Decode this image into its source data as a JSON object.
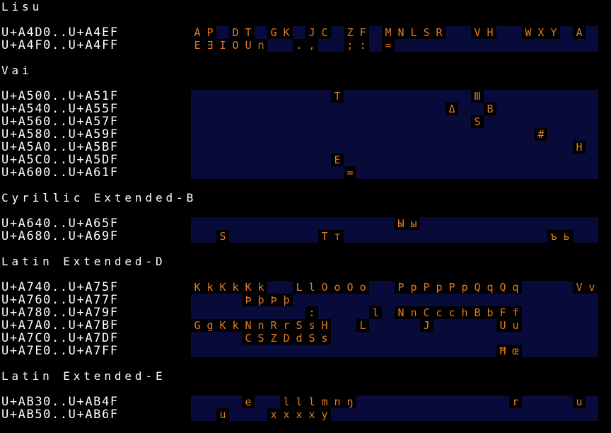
{
  "colors": {
    "background": "#000000",
    "label_text": "#ffffff",
    "row_background": "#080a3a",
    "cell_background": "#000000",
    "glyph_text": "#e07b2a"
  },
  "sections": [
    {
      "title": "Lisu",
      "rows": [
        {
          "range": "U+A4D0..U+A4EF",
          "cells": [
            [
              0,
              "A"
            ],
            [
              1,
              "P"
            ],
            [
              3,
              "D"
            ],
            [
              4,
              "T"
            ],
            [
              6,
              "G"
            ],
            [
              7,
              "K"
            ],
            [
              9,
              "J"
            ],
            [
              10,
              "C"
            ],
            [
              12,
              "Z"
            ],
            [
              13,
              "F"
            ],
            [
              15,
              "M"
            ],
            [
              16,
              "N"
            ],
            [
              17,
              "L"
            ],
            [
              18,
              "S"
            ],
            [
              19,
              "R"
            ],
            [
              22,
              "V"
            ],
            [
              23,
              "H"
            ],
            [
              26,
              "W"
            ],
            [
              27,
              "X"
            ],
            [
              28,
              "Y"
            ],
            [
              30,
              "A"
            ]
          ]
        },
        {
          "range": "U+A4F0..U+A4FF",
          "cells": [
            [
              0,
              "E"
            ],
            [
              1,
              "∃"
            ],
            [
              2,
              "I"
            ],
            [
              3,
              "O"
            ],
            [
              4,
              "U"
            ],
            [
              5,
              "∩"
            ],
            [
              8,
              "."
            ],
            [
              9,
              ","
            ],
            [
              12,
              ";"
            ],
            [
              13,
              ":"
            ],
            [
              15,
              "="
            ]
          ]
        }
      ]
    },
    {
      "title": "Vai",
      "rows": [
        {
          "range": "U+A500..U+A51F",
          "cells": [
            [
              11,
              "T"
            ],
            [
              22,
              "Ⅲ"
            ]
          ]
        },
        {
          "range": "U+A540..U+A55F",
          "cells": [
            [
              20,
              "Δ"
            ],
            [
              23,
              "B"
            ]
          ]
        },
        {
          "range": "U+A560..U+A57F",
          "cells": [
            [
              22,
              "S"
            ]
          ]
        },
        {
          "range": "U+A580..U+A59F",
          "cells": [
            [
              27,
              "#"
            ]
          ]
        },
        {
          "range": "U+A5A0..U+A5BF",
          "cells": [
            [
              30,
              "H"
            ]
          ]
        },
        {
          "range": "U+A5C0..U+A5DF",
          "cells": [
            [
              11,
              "E"
            ]
          ]
        },
        {
          "range": "U+A600..U+A61F",
          "cells": [
            [
              12,
              "="
            ]
          ]
        }
      ]
    },
    {
      "title": "Cyrillic Extended-B",
      "rows": [
        {
          "range": "U+A640..U+A65F",
          "cells": [
            [
              16,
              "Ы"
            ],
            [
              17,
              "ы"
            ]
          ]
        },
        {
          "range": "U+A680..U+A69F",
          "cells": [
            [
              2,
              "S"
            ],
            [
              10,
              "T"
            ],
            [
              11,
              "т"
            ],
            [
              28,
              "ъ"
            ],
            [
              29,
              "ь"
            ]
          ]
        }
      ]
    },
    {
      "title": "Latin Extended-D",
      "rows": [
        {
          "range": "U+A740..U+A75F",
          "cells": [
            [
              0,
              "K"
            ],
            [
              1,
              "k"
            ],
            [
              2,
              "K"
            ],
            [
              3,
              "k"
            ],
            [
              4,
              "K"
            ],
            [
              5,
              "k"
            ],
            [
              8,
              "L"
            ],
            [
              9,
              "l"
            ],
            [
              10,
              "O"
            ],
            [
              11,
              "o"
            ],
            [
              12,
              "O"
            ],
            [
              13,
              "o"
            ],
            [
              16,
              "P"
            ],
            [
              17,
              "p"
            ],
            [
              18,
              "P"
            ],
            [
              19,
              "p"
            ],
            [
              20,
              "P"
            ],
            [
              21,
              "p"
            ],
            [
              22,
              "Q"
            ],
            [
              23,
              "q"
            ],
            [
              24,
              "Q"
            ],
            [
              25,
              "q"
            ],
            [
              30,
              "V"
            ],
            [
              31,
              "v"
            ]
          ]
        },
        {
          "range": "U+A760..U+A77F",
          "cells": [
            [
              4,
              "Þ"
            ],
            [
              5,
              "þ"
            ],
            [
              6,
              "Þ"
            ],
            [
              7,
              "þ"
            ]
          ]
        },
        {
          "range": "U+A780..U+A79F",
          "cells": [
            [
              9,
              ":"
            ],
            [
              14,
              "l"
            ],
            [
              16,
              "N"
            ],
            [
              17,
              "n"
            ],
            [
              18,
              "C"
            ],
            [
              19,
              "c"
            ],
            [
              20,
              "c"
            ],
            [
              21,
              "h"
            ],
            [
              22,
              "B"
            ],
            [
              23,
              "b"
            ],
            [
              24,
              "F"
            ],
            [
              25,
              "f"
            ]
          ]
        },
        {
          "range": "U+A7A0..U+A7BF",
          "cells": [
            [
              0,
              "G"
            ],
            [
              1,
              "g"
            ],
            [
              2,
              "K"
            ],
            [
              3,
              "k"
            ],
            [
              4,
              "N"
            ],
            [
              5,
              "n"
            ],
            [
              6,
              "R"
            ],
            [
              7,
              "r"
            ],
            [
              8,
              "S"
            ],
            [
              9,
              "s"
            ],
            [
              10,
              "H"
            ],
            [
              13,
              "L"
            ],
            [
              18,
              "J"
            ],
            [
              24,
              "U"
            ],
            [
              25,
              "u"
            ]
          ]
        },
        {
          "range": "U+A7C0..U+A7DF",
          "cells": [
            [
              4,
              "C"
            ],
            [
              5,
              "S"
            ],
            [
              6,
              "Z"
            ],
            [
              7,
              "D"
            ],
            [
              8,
              "d"
            ],
            [
              9,
              "S"
            ],
            [
              10,
              "s"
            ]
          ]
        },
        {
          "range": "U+A7E0..U+A7FF",
          "cells": [
            [
              24,
              "Ħ"
            ],
            [
              25,
              "œ"
            ]
          ]
        }
      ]
    },
    {
      "title": "Latin Extended-E",
      "rows": [
        {
          "range": "U+AB30..U+AB4F",
          "cells": [
            [
              4,
              "e"
            ],
            [
              7,
              "l"
            ],
            [
              8,
              "l"
            ],
            [
              9,
              "l"
            ],
            [
              10,
              "m"
            ],
            [
              11,
              "n"
            ],
            [
              12,
              "ŋ"
            ],
            [
              25,
              "r"
            ],
            [
              30,
              "u"
            ]
          ]
        },
        {
          "range": "U+AB50..U+AB6F",
          "cells": [
            [
              2,
              "u"
            ],
            [
              6,
              "x"
            ],
            [
              7,
              "x"
            ],
            [
              8,
              "x"
            ],
            [
              9,
              "x"
            ],
            [
              10,
              "y"
            ]
          ]
        }
      ]
    }
  ]
}
